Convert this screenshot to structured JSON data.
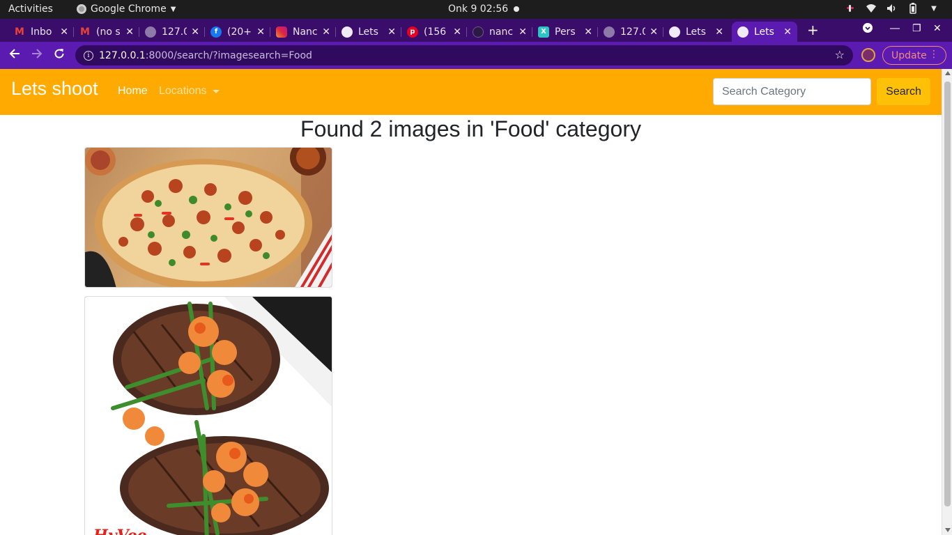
{
  "os_bar": {
    "activities": "Activities",
    "app_name": "Google Chrome",
    "clock": "Onk 9  02:56"
  },
  "tabs": [
    {
      "title": "Inbo",
      "favicon": "gmail-icon",
      "active": false
    },
    {
      "title": "(no s",
      "favicon": "gmail-icon",
      "active": false
    },
    {
      "title": "127.0",
      "favicon": "globe-icon",
      "active": false
    },
    {
      "title": "(20+",
      "favicon": "facebook-icon",
      "active": false
    },
    {
      "title": "Nanc",
      "favicon": "instagram-icon",
      "active": false
    },
    {
      "title": "Lets",
      "favicon": "globe-icon",
      "active": false
    },
    {
      "title": "(156",
      "favicon": "pinterest-icon",
      "active": false
    },
    {
      "title": "nanc",
      "favicon": "github-icon",
      "active": false
    },
    {
      "title": "Pers",
      "favicon": "x-icon",
      "active": false
    },
    {
      "title": "127.0",
      "favicon": "globe-icon",
      "active": false
    },
    {
      "title": "Lets",
      "favicon": "globe-icon",
      "active": false
    },
    {
      "title": "Lets",
      "favicon": "globe-icon",
      "active": true
    }
  ],
  "address_bar": {
    "host": "127.0.0.1",
    "path": ":8000/search/?imagesearch=Food"
  },
  "update_button": "Update",
  "navbar": {
    "brand": "Lets shoot",
    "home": "Home",
    "locations": "Locations",
    "search_placeholder": "Search Category",
    "search_button": "Search"
  },
  "results": {
    "heading": "Found 2 images in 'Food' category",
    "images": [
      {
        "alt": "pizza",
        "subject": "pizza-image"
      },
      {
        "alt": "steak with shrimp",
        "subject": "steak-image",
        "logo_text": "HyVee"
      }
    ]
  },
  "colors": {
    "navbar": "#ffaa00",
    "chrome_frame": "#5b1bb0",
    "search_button": "#ffc107"
  }
}
